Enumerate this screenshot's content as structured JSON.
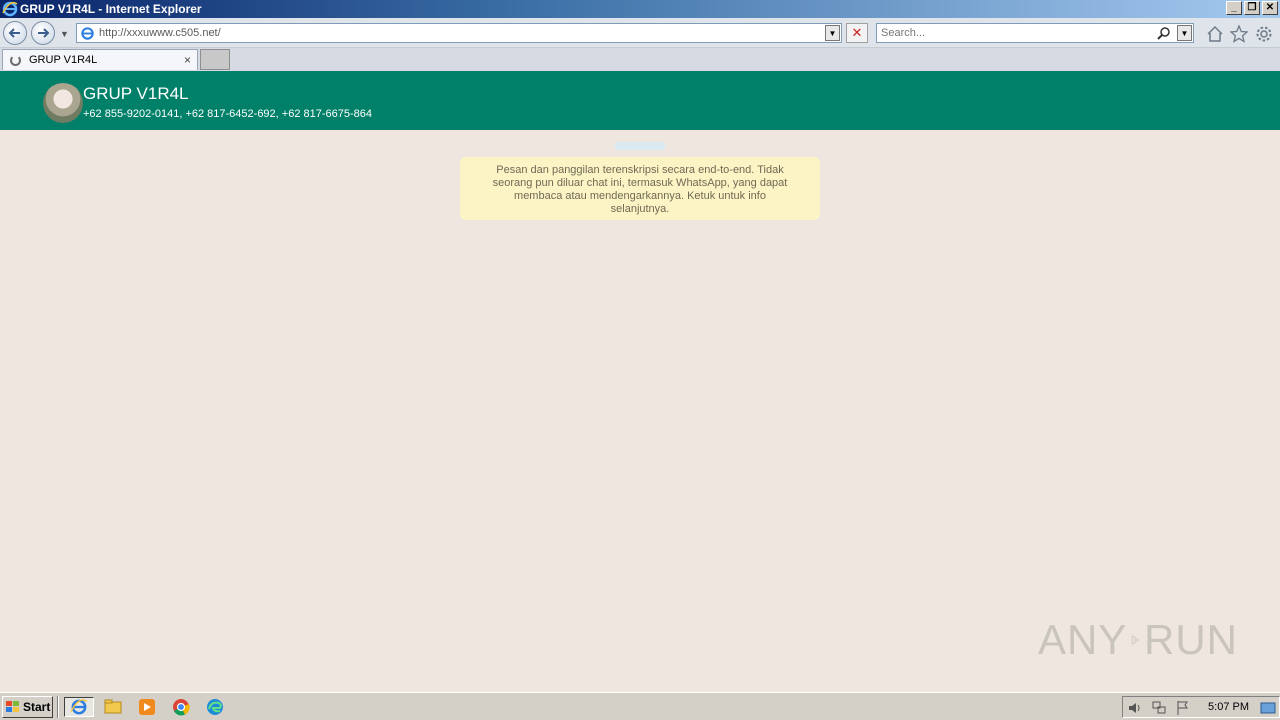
{
  "window": {
    "title": "GRUP V1R4L - Internet Explorer",
    "controls": [
      "minimize",
      "maximize",
      "close"
    ]
  },
  "toolbar": {
    "url": "http://xxxuwww.c505.net/",
    "search_placeholder": "Search..."
  },
  "tab": {
    "label": "GRUP V1R4L",
    "close": "×"
  },
  "chat_header": {
    "group_name": "GRUP V1R4L",
    "members": "+62 855-9202-0141, +62 817-6452-692, +62 817-6675-864"
  },
  "encryption_notice": "Pesan dan panggilan terenskripsi secara end-to-end. Tidak seorang pun diluar chat ini, termasuk WhatsApp, yang dapat membaca atau mendengarkannya. Ketuk untuk info selanjutnya.",
  "watermark": {
    "left": "ANY",
    "right": "RUN"
  },
  "taskbar": {
    "start_label": "Start",
    "clock": "5:07 PM",
    "pinned": [
      "internet-explorer-icon",
      "file-explorer-icon",
      "media-player-icon",
      "chrome-icon",
      "edge-icon"
    ]
  },
  "colors": {
    "header_green": "#008069",
    "chat_bg": "#efe7df",
    "notice_bg": "#fdf4c5"
  }
}
